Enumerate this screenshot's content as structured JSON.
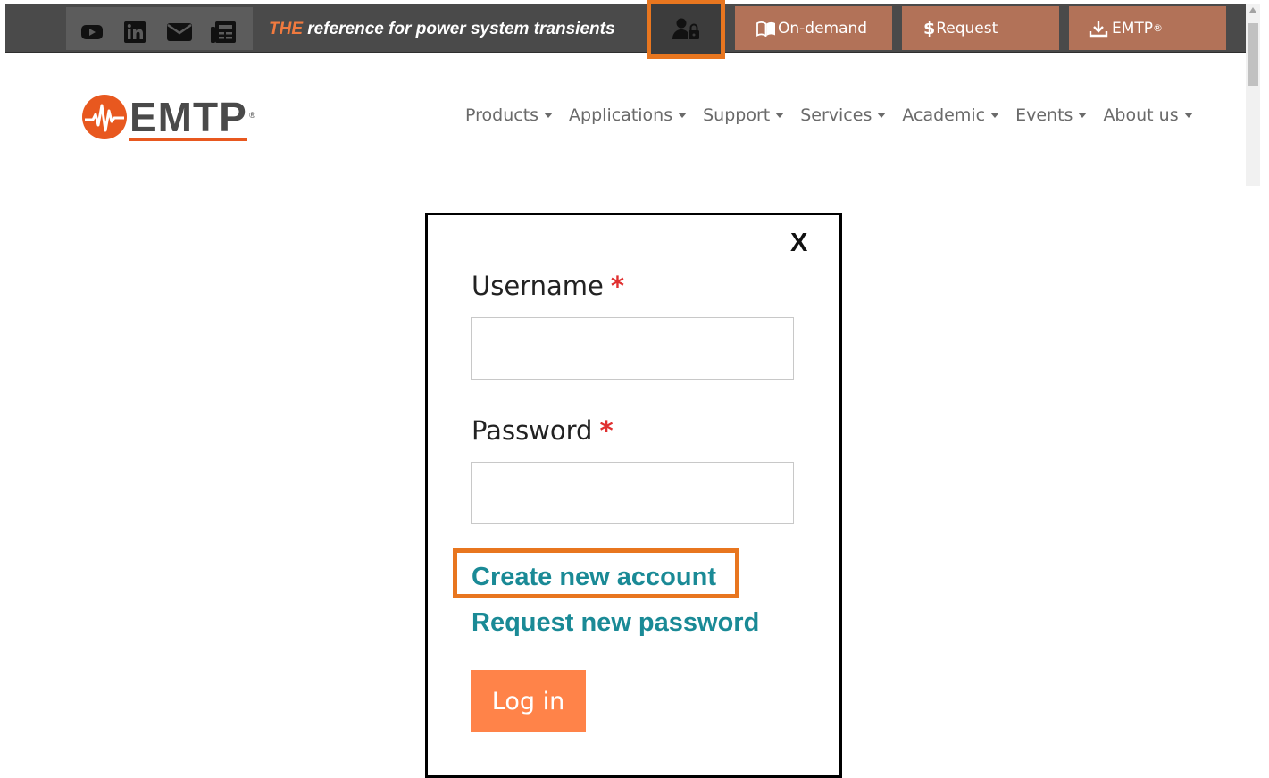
{
  "topbar": {
    "social_icons": [
      "youtube-icon",
      "linkedin-icon",
      "email-icon",
      "newsletter-icon"
    ],
    "tagline_prefix": "THE",
    "tagline_rest": " reference for power system transients",
    "login_icon": "user-lock-icon",
    "buttons": {
      "on_demand": {
        "glyph": "📖",
        "label": "On-demand"
      },
      "request": {
        "glyph": "$",
        "label": "Request"
      },
      "emtp": {
        "label": "EMTP",
        "sup": "®"
      }
    }
  },
  "header": {
    "logo_text": "EMTP",
    "logo_reg": "®"
  },
  "nav": {
    "items": [
      "Products",
      "Applications",
      "Support",
      "Services",
      "Academic",
      "Events",
      "About us"
    ]
  },
  "login_form": {
    "close_label": "X",
    "username_label": "Username",
    "password_label": "Password",
    "required_mark": "*",
    "username_value": "",
    "password_value": "",
    "create_account_link": "Create new account",
    "request_password_link": "Request new password",
    "login_button": "Log in"
  },
  "colors": {
    "topbar_bg": "#4a4a4a",
    "topbar_button": "#b27258",
    "highlight_orange": "#e8761f",
    "link_teal": "#1a8a96",
    "login_button": "#ff8349",
    "brand_orange": "#e8581f"
  }
}
